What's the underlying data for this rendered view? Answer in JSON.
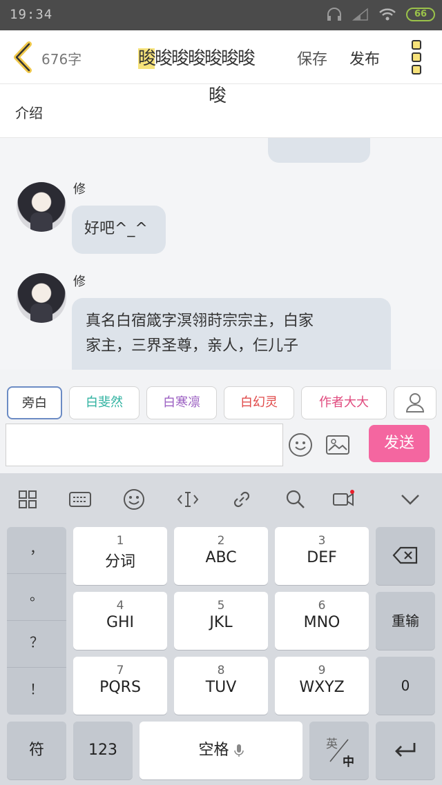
{
  "status": {
    "time": "19:34",
    "battery": "66"
  },
  "header": {
    "word_count": "676字",
    "title_first": "晙",
    "title_rest": "晙晙晙晙晙晙",
    "title_wrap": "晙",
    "save": "保存",
    "publish": "发布"
  },
  "intro": {
    "label": "介绍"
  },
  "messages": [
    {
      "name": "修",
      "text": "好吧^_^"
    },
    {
      "name": "修",
      "text_line1": "真名白宿箴字溟翎莳宗宗主，白家",
      "text_line2": "家主，三界圣尊，亲人，仨儿子"
    }
  ],
  "roles": [
    {
      "label": "旁白",
      "color": "#333333"
    },
    {
      "label": "白斐然",
      "color": "#2fb2a0"
    },
    {
      "label": "白寒凛",
      "color": "#9b5fc2"
    },
    {
      "label": "白幻灵",
      "color": "#e04848"
    },
    {
      "label": "作者大大",
      "color": "#e0497d"
    }
  ],
  "composer": {
    "send": "发送"
  },
  "keyboard": {
    "punct": [
      "，",
      "。",
      "？",
      "！"
    ],
    "rows": [
      [
        {
          "num": "1",
          "label": "分词"
        },
        {
          "num": "2",
          "label": "ABC"
        },
        {
          "num": "3",
          "label": "DEF"
        }
      ],
      [
        {
          "num": "4",
          "label": "GHI"
        },
        {
          "num": "5",
          "label": "JKL"
        },
        {
          "num": "6",
          "label": "MNO"
        }
      ],
      [
        {
          "num": "7",
          "label": "PQRS"
        },
        {
          "num": "8",
          "label": "TUV"
        },
        {
          "num": "9",
          "label": "WXYZ"
        }
      ]
    ],
    "retype": "重输",
    "zero": "0",
    "symbols": "符",
    "numbers": "123",
    "space": "空格",
    "lang_top": "英",
    "lang_bottom": "中"
  }
}
